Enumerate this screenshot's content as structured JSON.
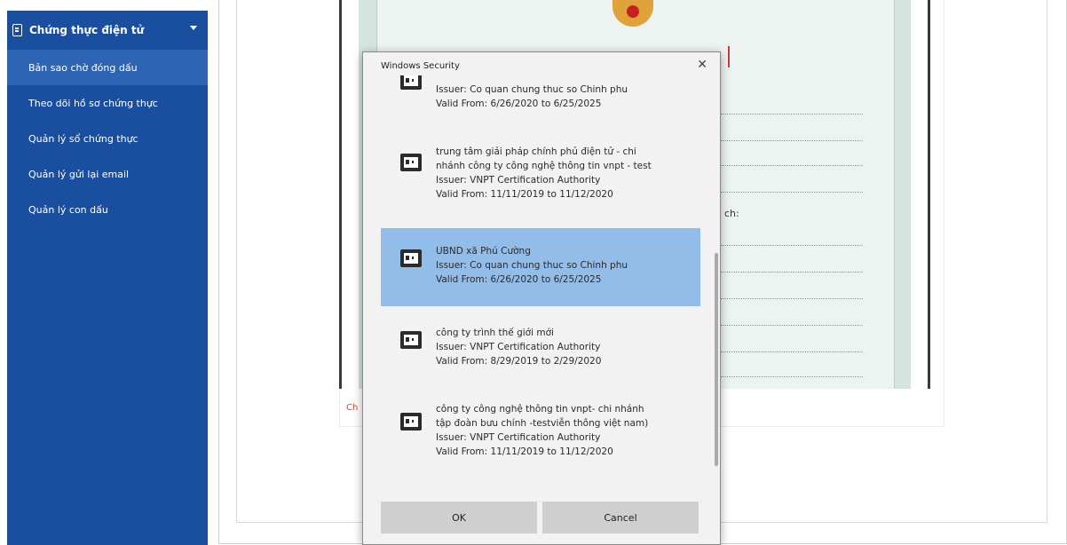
{
  "sidebar": {
    "header": "Chứng thực điện tử",
    "items": [
      {
        "label": "Bản sao chờ đóng dấu"
      },
      {
        "label": "Theo dõi hồ sơ chứng thực"
      },
      {
        "label": "Quản lý sổ chứng thực"
      },
      {
        "label": "Quản lý gửi lại email"
      },
      {
        "label": "Quản lý con dấu"
      }
    ]
  },
  "background": {
    "field_fragment": "ch:",
    "side_fragment": "Ch"
  },
  "dialog": {
    "title": "Windows Security",
    "close_glyph": "✕",
    "certificates": [
      {
        "lines": [
          "Issuer: Co quan chung thuc so Chinh phu",
          "Valid From: 6/26/2020 to 6/25/2025"
        ]
      },
      {
        "lines": [
          "trung tâm giải pháp chính phủ điện tử - chi",
          "nhánh công ty công nghệ thông tin vnpt - test",
          "Issuer: VNPT Certification Authority",
          "Valid From: 11/11/2019 to 11/12/2020"
        ]
      },
      {
        "lines": [
          "UBND xã Phú Cường",
          "Issuer: Co quan chung thuc so Chinh phu",
          "Valid From: 6/26/2020 to 6/25/2025"
        ],
        "selected": true
      },
      {
        "lines": [
          "công ty trình thế giới mới",
          "Issuer: VNPT Certification Authority",
          "Valid From: 8/29/2019 to 2/29/2020"
        ]
      },
      {
        "lines": [
          "công ty công nghệ thông tin vnpt- chi nhánh",
          "tập đoàn bưu chính -testviễn thông việt nam)",
          "Issuer: VNPT Certification Authority",
          "Valid From: 11/11/2019 to 11/12/2020"
        ]
      }
    ],
    "ok_label": "OK",
    "cancel_label": "Cancel"
  }
}
